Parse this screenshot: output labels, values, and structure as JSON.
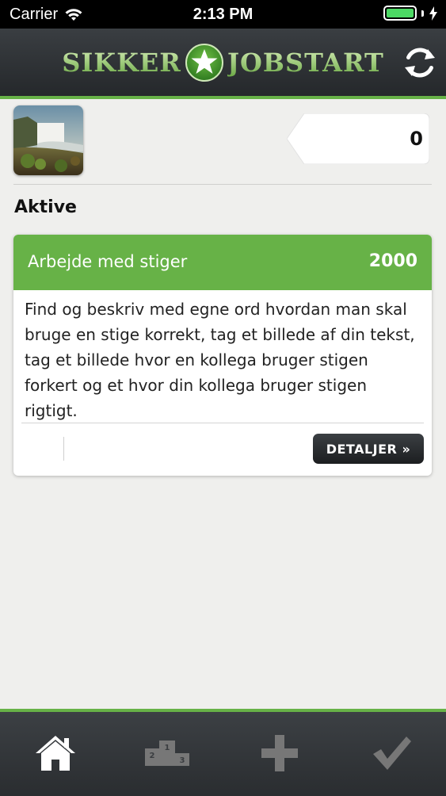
{
  "status_bar": {
    "carrier": "Carrier",
    "time": "2:13 PM",
    "battery_level": 1.0
  },
  "header": {
    "logo_left": "SIKKER",
    "logo_right": "JOBSTART",
    "logo_icon": "star-icon",
    "refresh_icon": "refresh-icon"
  },
  "profile": {
    "score": "0"
  },
  "section": {
    "title": "Aktive"
  },
  "tasks": [
    {
      "title": "Arbejde med stiger",
      "points": "2000",
      "description": "Find og beskriv med egne ord hvordan man skal bruge en stige korrekt, tag et billede af din tekst, tag et billede hvor en kollega bruger stigen forkert og et hvor din kollega bruger stigen rigtigt.",
      "details_label": "DETALJER »"
    }
  ],
  "tabbar": {
    "items": [
      "home-icon",
      "podium-icon",
      "plus-icon",
      "checkmark-icon"
    ]
  },
  "colors": {
    "accent": "#67b247",
    "header_dark": "#2a2d30"
  }
}
